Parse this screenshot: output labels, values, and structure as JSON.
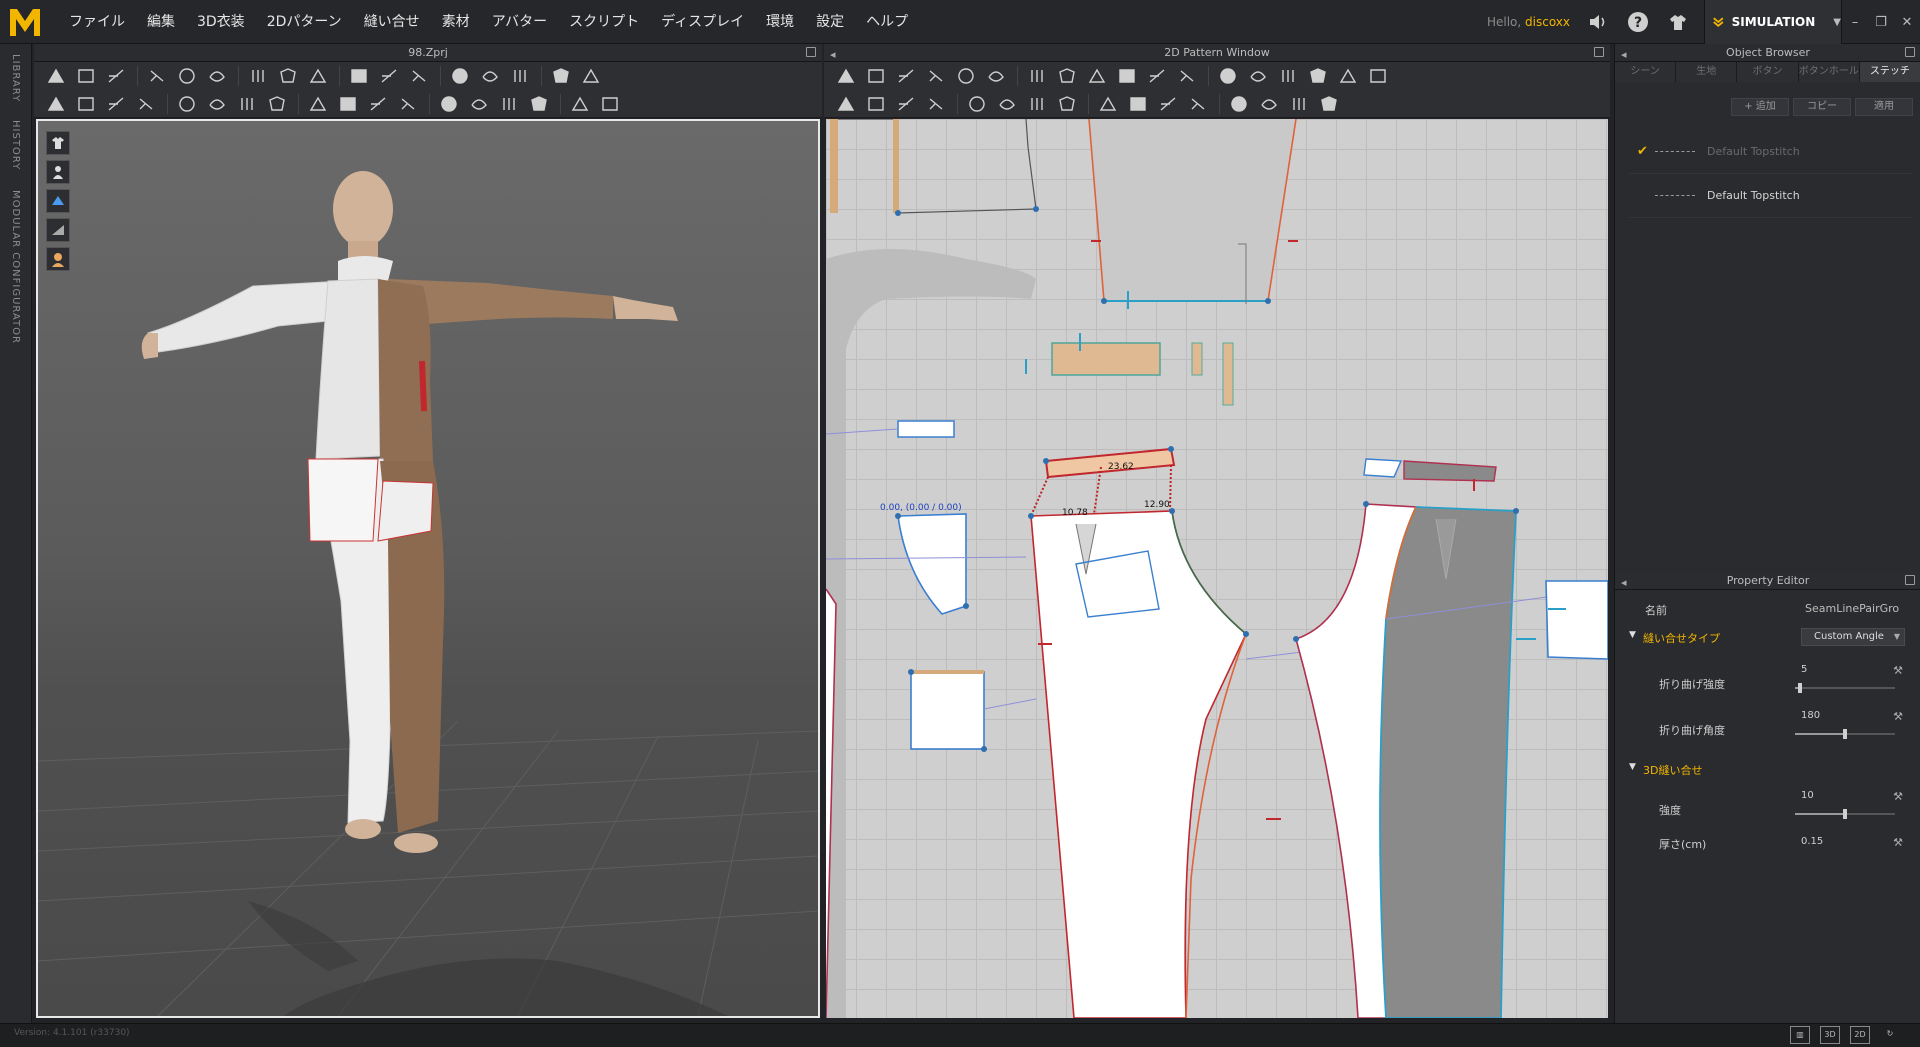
{
  "app": {
    "file_name": "98.Zprj",
    "logo_letter": "M",
    "hello_label": "Hello,",
    "user_name": "discoxx",
    "simulation_label": "SIMULATION",
    "version": "Version: 4.1.101 (r33730)",
    "accent_color": "#f2b600"
  },
  "menu": [
    "ファイル",
    "編集",
    "3D衣装",
    "2Dパターン",
    "縫い合せ",
    "素材",
    "アバター",
    "スクリプト",
    "ディスプレイ",
    "環境",
    "設定",
    "ヘルプ"
  ],
  "side_tabs": [
    "LIBRARY",
    "HISTORY",
    "MODULAR CONFIGURATOR"
  ],
  "panels": {
    "view3d_title": "98.Zprj",
    "view2d_title": "2D Pattern Window",
    "object_browser_title": "Object Browser",
    "property_editor_title": "Property Editor"
  },
  "pattern_labels": {
    "waistband_length": "23.62",
    "pocket_coord": "0.00, (0.00 / 0.00)",
    "dart_left": "10.78",
    "dart_right": "12.90"
  },
  "object_browser": {
    "tabs": [
      "シーン",
      "生地",
      "ボタン",
      "ボタンホール",
      "ステッチ"
    ],
    "active_tab": "ステッチ",
    "buttons": [
      "+ 追加",
      "コピー",
      "適用"
    ],
    "items": [
      {
        "name": "Default Topstitch",
        "checked": true
      },
      {
        "name": "Default Topstitch",
        "checked": false
      }
    ]
  },
  "property_editor": {
    "name_label": "名前",
    "name_value": "SeamLinePairGro",
    "section1": "縫い合せタイプ",
    "section1_value": "Custom Angle",
    "fold_strength_label": "折り曲げ強度",
    "fold_strength_value": "5",
    "fold_strength_fraction": 0.05,
    "fold_angle_label": "折り曲げ角度",
    "fold_angle_value": "180",
    "fold_angle_fraction": 0.5,
    "section2": "3D縫い合せ",
    "strength_label": "強度",
    "strength_value": "10",
    "strength_fraction": 0.5,
    "thickness_label": "厚さ(cm)",
    "thickness_value": "0.15"
  },
  "status_modes": [
    "▥",
    "3D",
    "2D"
  ]
}
